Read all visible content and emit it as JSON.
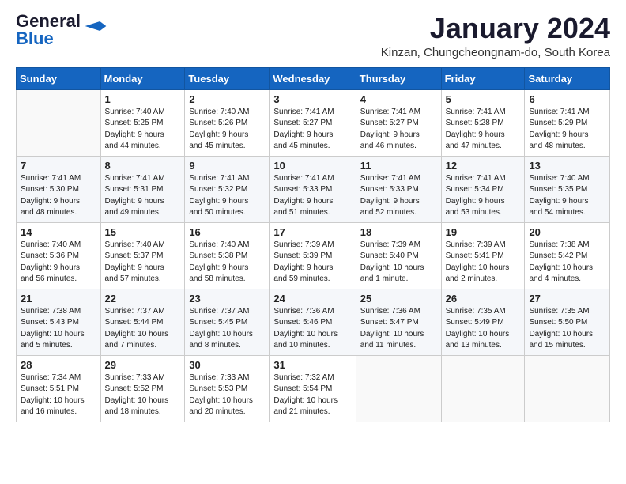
{
  "header": {
    "logo_general": "General",
    "logo_blue": "Blue",
    "month": "January 2024",
    "location": "Kinzan, Chungcheongnam-do, South Korea"
  },
  "weekdays": [
    "Sunday",
    "Monday",
    "Tuesday",
    "Wednesday",
    "Thursday",
    "Friday",
    "Saturday"
  ],
  "weeks": [
    [
      {
        "day": "",
        "info": ""
      },
      {
        "day": "1",
        "info": "Sunrise: 7:40 AM\nSunset: 5:25 PM\nDaylight: 9 hours\nand 44 minutes."
      },
      {
        "day": "2",
        "info": "Sunrise: 7:40 AM\nSunset: 5:26 PM\nDaylight: 9 hours\nand 45 minutes."
      },
      {
        "day": "3",
        "info": "Sunrise: 7:41 AM\nSunset: 5:27 PM\nDaylight: 9 hours\nand 45 minutes."
      },
      {
        "day": "4",
        "info": "Sunrise: 7:41 AM\nSunset: 5:27 PM\nDaylight: 9 hours\nand 46 minutes."
      },
      {
        "day": "5",
        "info": "Sunrise: 7:41 AM\nSunset: 5:28 PM\nDaylight: 9 hours\nand 47 minutes."
      },
      {
        "day": "6",
        "info": "Sunrise: 7:41 AM\nSunset: 5:29 PM\nDaylight: 9 hours\nand 48 minutes."
      }
    ],
    [
      {
        "day": "7",
        "info": "Sunrise: 7:41 AM\nSunset: 5:30 PM\nDaylight: 9 hours\nand 48 minutes."
      },
      {
        "day": "8",
        "info": "Sunrise: 7:41 AM\nSunset: 5:31 PM\nDaylight: 9 hours\nand 49 minutes."
      },
      {
        "day": "9",
        "info": "Sunrise: 7:41 AM\nSunset: 5:32 PM\nDaylight: 9 hours\nand 50 minutes."
      },
      {
        "day": "10",
        "info": "Sunrise: 7:41 AM\nSunset: 5:33 PM\nDaylight: 9 hours\nand 51 minutes."
      },
      {
        "day": "11",
        "info": "Sunrise: 7:41 AM\nSunset: 5:33 PM\nDaylight: 9 hours\nand 52 minutes."
      },
      {
        "day": "12",
        "info": "Sunrise: 7:41 AM\nSunset: 5:34 PM\nDaylight: 9 hours\nand 53 minutes."
      },
      {
        "day": "13",
        "info": "Sunrise: 7:40 AM\nSunset: 5:35 PM\nDaylight: 9 hours\nand 54 minutes."
      }
    ],
    [
      {
        "day": "14",
        "info": "Sunrise: 7:40 AM\nSunset: 5:36 PM\nDaylight: 9 hours\nand 56 minutes."
      },
      {
        "day": "15",
        "info": "Sunrise: 7:40 AM\nSunset: 5:37 PM\nDaylight: 9 hours\nand 57 minutes."
      },
      {
        "day": "16",
        "info": "Sunrise: 7:40 AM\nSunset: 5:38 PM\nDaylight: 9 hours\nand 58 minutes."
      },
      {
        "day": "17",
        "info": "Sunrise: 7:39 AM\nSunset: 5:39 PM\nDaylight: 9 hours\nand 59 minutes."
      },
      {
        "day": "18",
        "info": "Sunrise: 7:39 AM\nSunset: 5:40 PM\nDaylight: 10 hours\nand 1 minute."
      },
      {
        "day": "19",
        "info": "Sunrise: 7:39 AM\nSunset: 5:41 PM\nDaylight: 10 hours\nand 2 minutes."
      },
      {
        "day": "20",
        "info": "Sunrise: 7:38 AM\nSunset: 5:42 PM\nDaylight: 10 hours\nand 4 minutes."
      }
    ],
    [
      {
        "day": "21",
        "info": "Sunrise: 7:38 AM\nSunset: 5:43 PM\nDaylight: 10 hours\nand 5 minutes."
      },
      {
        "day": "22",
        "info": "Sunrise: 7:37 AM\nSunset: 5:44 PM\nDaylight: 10 hours\nand 7 minutes."
      },
      {
        "day": "23",
        "info": "Sunrise: 7:37 AM\nSunset: 5:45 PM\nDaylight: 10 hours\nand 8 minutes."
      },
      {
        "day": "24",
        "info": "Sunrise: 7:36 AM\nSunset: 5:46 PM\nDaylight: 10 hours\nand 10 minutes."
      },
      {
        "day": "25",
        "info": "Sunrise: 7:36 AM\nSunset: 5:47 PM\nDaylight: 10 hours\nand 11 minutes."
      },
      {
        "day": "26",
        "info": "Sunrise: 7:35 AM\nSunset: 5:49 PM\nDaylight: 10 hours\nand 13 minutes."
      },
      {
        "day": "27",
        "info": "Sunrise: 7:35 AM\nSunset: 5:50 PM\nDaylight: 10 hours\nand 15 minutes."
      }
    ],
    [
      {
        "day": "28",
        "info": "Sunrise: 7:34 AM\nSunset: 5:51 PM\nDaylight: 10 hours\nand 16 minutes."
      },
      {
        "day": "29",
        "info": "Sunrise: 7:33 AM\nSunset: 5:52 PM\nDaylight: 10 hours\nand 18 minutes."
      },
      {
        "day": "30",
        "info": "Sunrise: 7:33 AM\nSunset: 5:53 PM\nDaylight: 10 hours\nand 20 minutes."
      },
      {
        "day": "31",
        "info": "Sunrise: 7:32 AM\nSunset: 5:54 PM\nDaylight: 10 hours\nand 21 minutes."
      },
      {
        "day": "",
        "info": ""
      },
      {
        "day": "",
        "info": ""
      },
      {
        "day": "",
        "info": ""
      }
    ]
  ]
}
